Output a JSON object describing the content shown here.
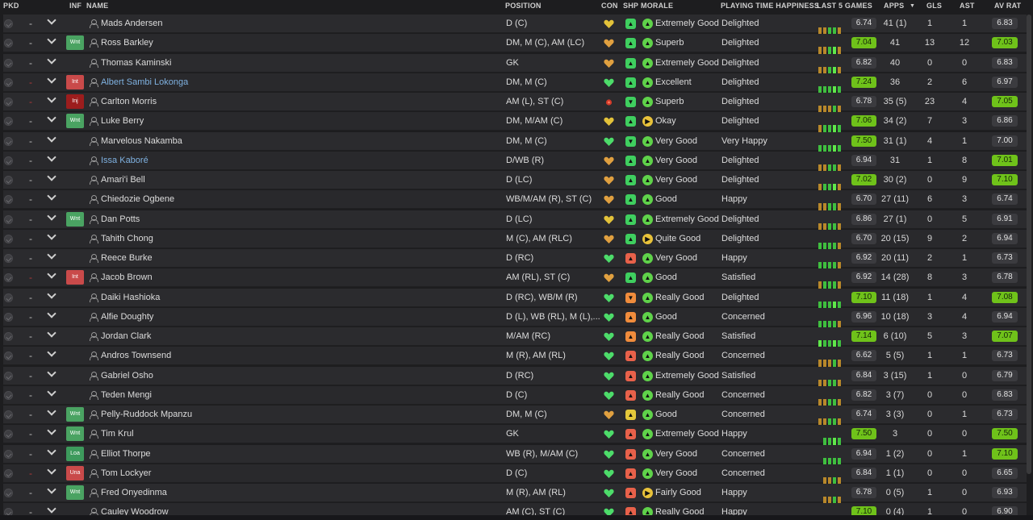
{
  "headers": {
    "pkd": "PKD",
    "inf": "INF",
    "name": "NAME",
    "position": "POSITION",
    "con": "CON",
    "shp": "SHP",
    "morale": "MORALE",
    "pth": "PLAYING TIME HAPPINESS",
    "last5": "LAST 5 GAMES",
    "apps": "APPS",
    "gls": "GLS",
    "ast": "AST",
    "avrat": "AV RAT"
  },
  "colors": {
    "rating_green": "#6fc21a",
    "accent_blue": "#7fb1e0",
    "wnt": "#4aa362",
    "int": "#c94a4a",
    "inj": "#9c1d1d"
  },
  "players": [
    {
      "dash": "-",
      "inf": "",
      "name": "Mads Andersen",
      "position": "D (C)",
      "con": "yellow",
      "shp": "up",
      "morale": "Extremely Good",
      "morale_icon": "up",
      "happiness": "Delighted",
      "bars": [
        "o",
        "o",
        "g",
        "g",
        "o"
      ],
      "r5": "6.74",
      "r5_hi": false,
      "apps": "41 (1)",
      "gls": "1",
      "ast": "1",
      "av": "6.83",
      "av_hi": false
    },
    {
      "dash": "-",
      "inf": "Wnt",
      "name": "Ross Barkley",
      "position": "DM, M (C), AM (LC)",
      "con": "orange",
      "shp": "up",
      "morale": "Superb",
      "morale_icon": "up",
      "happiness": "Delighted",
      "bars": [
        "o",
        "o",
        "g",
        "G",
        "o"
      ],
      "r5": "7.04",
      "r5_hi": true,
      "apps": "41",
      "gls": "13",
      "ast": "12",
      "av": "7.03",
      "av_hi": true
    },
    {
      "dash": "-",
      "inf": "",
      "name": "Thomas Kaminski",
      "position": "GK",
      "con": "orange",
      "shp": "up",
      "morale": "Extremely Good",
      "morale_icon": "up",
      "happiness": "Delighted",
      "bars": [
        "o",
        "o",
        "g",
        "G",
        "o"
      ],
      "r5": "6.82",
      "r5_hi": false,
      "apps": "40",
      "gls": "0",
      "ast": "0",
      "av": "6.83",
      "av_hi": false
    },
    {
      "dash": "-",
      "inf": "Int",
      "name": "Albert Sambi Lokonga",
      "link": true,
      "position": "DM, M (C)",
      "con": "green",
      "shp": "up",
      "morale": "Excellent",
      "morale_icon": "up",
      "happiness": "Delighted",
      "bars": [
        "g",
        "g",
        "g",
        "G",
        "g"
      ],
      "r5": "7.24",
      "r5_hi": true,
      "apps": "36",
      "gls": "2",
      "ast": "6",
      "av": "6.97",
      "av_hi": false
    },
    {
      "dash": "-",
      "inf": "Inj",
      "name": "Carlton Morris",
      "position": "AM (L), ST (C)",
      "con": "injury",
      "shp": "down",
      "morale": "Superb",
      "morale_icon": "up",
      "happiness": "Delighted",
      "bars": [
        "o",
        "o",
        "o",
        "g",
        "o"
      ],
      "r5": "6.78",
      "r5_hi": false,
      "apps": "35 (5)",
      "gls": "23",
      "ast": "4",
      "av": "7.05",
      "av_hi": true
    },
    {
      "dash": "-",
      "inf": "Wnt",
      "name": "Luke Berry",
      "position": "DM, M/AM (C)",
      "con": "yellow",
      "shp": "up",
      "morale": "Okay",
      "morale_icon": "right",
      "happiness": "Delighted",
      "bars": [
        "o",
        "g",
        "g",
        "G",
        "g"
      ],
      "r5": "7.06",
      "r5_hi": true,
      "apps": "34 (2)",
      "gls": "7",
      "ast": "3",
      "av": "6.86",
      "av_hi": false
    },
    {
      "dash": "-",
      "inf": "",
      "name": "Marvelous Nakamba",
      "position": "DM, M (C)",
      "con": "green",
      "shp": "down",
      "morale": "Very Good",
      "morale_icon": "up",
      "happiness": "Very Happy",
      "bars": [
        "g",
        "g",
        "g",
        "G",
        "g"
      ],
      "r5": "7.50",
      "r5_hi": true,
      "apps": "31 (1)",
      "gls": "4",
      "ast": "1",
      "av": "7.00",
      "av_hi": false
    },
    {
      "dash": "-",
      "inf": "",
      "name": "Issa Kaboré",
      "link": true,
      "position": "D/WB (R)",
      "con": "orange",
      "shp": "up",
      "morale": "Very Good",
      "morale_icon": "up",
      "happiness": "Delighted",
      "bars": [
        "o",
        "o",
        "g",
        "g",
        "o"
      ],
      "r5": "6.94",
      "r5_hi": false,
      "apps": "31",
      "gls": "1",
      "ast": "8",
      "av": "7.01",
      "av_hi": true
    },
    {
      "dash": "-",
      "inf": "",
      "name": "Amari'i Bell",
      "position": "D (LC)",
      "con": "orange",
      "shp": "up",
      "morale": "Very Good",
      "morale_icon": "up",
      "happiness": "Delighted",
      "bars": [
        "o",
        "g",
        "g",
        "G",
        "o"
      ],
      "r5": "7.02",
      "r5_hi": true,
      "apps": "30 (2)",
      "gls": "0",
      "ast": "9",
      "av": "7.10",
      "av_hi": true
    },
    {
      "dash": "-",
      "inf": "",
      "name": "Chiedozie Ogbene",
      "position": "WB/M/AM (R), ST (C)",
      "con": "orange",
      "shp": "up",
      "morale": "Good",
      "morale_icon": "up",
      "happiness": "Happy",
      "bars": [
        "o",
        "o",
        "g",
        "g",
        "o"
      ],
      "r5": "6.70",
      "r5_hi": false,
      "apps": "27 (11)",
      "gls": "6",
      "ast": "3",
      "av": "6.74",
      "av_hi": false
    },
    {
      "dash": "-",
      "inf": "Wnt",
      "name": "Dan Potts",
      "position": "D (LC)",
      "con": "yellow",
      "shp": "up",
      "morale": "Extremely Good",
      "morale_icon": "up",
      "happiness": "Delighted",
      "bars": [
        "o",
        "o",
        "g",
        "g",
        "o"
      ],
      "r5": "6.86",
      "r5_hi": false,
      "apps": "27 (1)",
      "gls": "0",
      "ast": "5",
      "av": "6.91",
      "av_hi": false
    },
    {
      "dash": "-",
      "inf": "",
      "name": "Tahith Chong",
      "position": "M (C), AM (RLC)",
      "con": "orange",
      "shp": "up",
      "morale": "Quite Good",
      "morale_icon": "right",
      "happiness": "Delighted",
      "bars": [
        "g",
        "g",
        "g",
        "g",
        "o"
      ],
      "r5": "6.70",
      "r5_hi": false,
      "apps": "20 (15)",
      "gls": "9",
      "ast": "2",
      "av": "6.94",
      "av_hi": false
    },
    {
      "dash": "-",
      "inf": "",
      "name": "Reece Burke",
      "position": "D (RC)",
      "con": "green",
      "shp": "red",
      "morale": "Very Good",
      "morale_icon": "up",
      "happiness": "Happy",
      "bars": [
        "g",
        "g",
        "g",
        "g",
        "o"
      ],
      "r5": "6.92",
      "r5_hi": false,
      "apps": "20 (11)",
      "gls": "2",
      "ast": "1",
      "av": "6.73",
      "av_hi": false
    },
    {
      "dash": "-",
      "inf": "Int",
      "name": "Jacob Brown",
      "position": "AM (RL), ST (C)",
      "con": "orange",
      "shp": "up",
      "morale": "Good",
      "morale_icon": "up",
      "happiness": "Satisfied",
      "bars": [
        "o",
        "g",
        "g",
        "g",
        "o"
      ],
      "r5": "6.92",
      "r5_hi": false,
      "apps": "14 (28)",
      "gls": "8",
      "ast": "3",
      "av": "6.78",
      "av_hi": false
    },
    {
      "dash": "-",
      "inf": "",
      "name": "Daiki Hashioka",
      "position": "D (RC), WB/M (R)",
      "con": "green",
      "shp": "orangedown",
      "morale": "Really Good",
      "morale_icon": "up",
      "happiness": "Delighted",
      "bars": [
        "g",
        "g",
        "g",
        "G",
        "g"
      ],
      "r5": "7.10",
      "r5_hi": true,
      "apps": "11 (18)",
      "gls": "1",
      "ast": "4",
      "av": "7.08",
      "av_hi": true
    },
    {
      "dash": "-",
      "inf": "",
      "name": "Alfie Doughty",
      "position": "D (L), WB (RL), M (L),...",
      "con": "green",
      "shp": "orangeup",
      "morale": "Good",
      "morale_icon": "up",
      "happiness": "Concerned",
      "bars": [
        "g",
        "g",
        "g",
        "g",
        "o"
      ],
      "r5": "6.96",
      "r5_hi": false,
      "apps": "10 (18)",
      "gls": "3",
      "ast": "4",
      "av": "6.94",
      "av_hi": false
    },
    {
      "dash": "-",
      "inf": "",
      "name": "Jordan Clark",
      "position": "M/AM (RC)",
      "con": "green",
      "shp": "orangeup",
      "morale": "Really Good",
      "morale_icon": "up",
      "happiness": "Satisfied",
      "bars": [
        "G",
        "g",
        "g",
        "G",
        "g"
      ],
      "r5": "7.14",
      "r5_hi": true,
      "apps": "6 (10)",
      "gls": "5",
      "ast": "3",
      "av": "7.07",
      "av_hi": true
    },
    {
      "dash": "-",
      "inf": "",
      "name": "Andros Townsend",
      "position": "M (R), AM (RL)",
      "con": "green",
      "shp": "red",
      "morale": "Really Good",
      "morale_icon": "up",
      "happiness": "Concerned",
      "bars": [
        "o",
        "o",
        "o",
        "g",
        "o"
      ],
      "r5": "6.62",
      "r5_hi": false,
      "apps": "5 (5)",
      "gls": "1",
      "ast": "1",
      "av": "6.73",
      "av_hi": false
    },
    {
      "dash": "-",
      "inf": "",
      "name": "Gabriel Osho",
      "position": "D (RC)",
      "con": "green",
      "shp": "red",
      "morale": "Extremely Good",
      "morale_icon": "up",
      "happiness": "Satisfied",
      "bars": [
        "o",
        "o",
        "g",
        "g",
        "o"
      ],
      "r5": "6.84",
      "r5_hi": false,
      "apps": "3 (15)",
      "gls": "1",
      "ast": "0",
      "av": "6.79",
      "av_hi": false
    },
    {
      "dash": "-",
      "inf": "",
      "name": "Teden Mengi",
      "position": "D (C)",
      "con": "green",
      "shp": "red",
      "morale": "Really Good",
      "morale_icon": "up",
      "happiness": "Concerned",
      "bars": [
        "o",
        "o",
        "g",
        "g",
        "o"
      ],
      "r5": "6.82",
      "r5_hi": false,
      "apps": "3 (7)",
      "gls": "0",
      "ast": "0",
      "av": "6.83",
      "av_hi": false
    },
    {
      "dash": "-",
      "inf": "Wnt",
      "name": "Pelly-Ruddock Mpanzu",
      "position": "DM, M (C)",
      "con": "orange",
      "shp": "yellowup",
      "morale": "Good",
      "morale_icon": "up",
      "happiness": "Concerned",
      "bars": [
        "o",
        "o",
        "g",
        "g",
        "o"
      ],
      "r5": "6.74",
      "r5_hi": false,
      "apps": "3 (3)",
      "gls": "0",
      "ast": "1",
      "av": "6.73",
      "av_hi": false
    },
    {
      "dash": "-",
      "inf": "Wnt",
      "name": "Tim Krul",
      "position": "GK",
      "con": "green",
      "shp": "red",
      "morale": "Extremely Good",
      "morale_icon": "up",
      "happiness": "Happy",
      "bars": [
        "",
        "g",
        "g",
        "G",
        "g"
      ],
      "r5": "7.50",
      "r5_hi": true,
      "apps": "3",
      "gls": "0",
      "ast": "0",
      "av": "7.50",
      "av_hi": true
    },
    {
      "dash": "-",
      "inf": "Loa",
      "name": "Elliot Thorpe",
      "position": "WB (R), M/AM (C)",
      "con": "green",
      "shp": "red",
      "morale": "Very Good",
      "morale_icon": "up",
      "happiness": "Concerned",
      "bars": [
        "",
        "g",
        "g",
        "g",
        "g"
      ],
      "r5": "6.94",
      "r5_hi": false,
      "apps": "1 (2)",
      "gls": "0",
      "ast": "1",
      "av": "7.10",
      "av_hi": true
    },
    {
      "dash": "-",
      "inf": "Una",
      "name": "Tom Lockyer",
      "position": "D (C)",
      "con": "green",
      "shp": "red",
      "morale": "Very Good",
      "morale_icon": "up",
      "happiness": "Concerned",
      "bars": [
        "",
        "o",
        "o",
        "g",
        "o"
      ],
      "r5": "6.84",
      "r5_hi": false,
      "apps": "1 (1)",
      "gls": "0",
      "ast": "0",
      "av": "6.65",
      "av_hi": false
    },
    {
      "dash": "-",
      "inf": "Wnt",
      "name": "Fred Onyedinma",
      "position": "M (R), AM (RL)",
      "con": "green",
      "shp": "red",
      "morale": "Fairly Good",
      "morale_icon": "right",
      "happiness": "Happy",
      "bars": [
        "",
        "o",
        "o",
        "g",
        "o"
      ],
      "r5": "6.78",
      "r5_hi": false,
      "apps": "0 (5)",
      "gls": "1",
      "ast": "0",
      "av": "6.93",
      "av_hi": false
    },
    {
      "dash": "-",
      "inf": "",
      "name": "Cauley Woodrow",
      "position": "AM (C), ST (C)",
      "con": "green",
      "shp": "red",
      "morale": "Really Good",
      "morale_icon": "up",
      "happiness": "Happy",
      "bars": [
        "",
        "g",
        "g",
        "G",
        "g"
      ],
      "r5": "7.10",
      "r5_hi": true,
      "apps": "0 (4)",
      "gls": "1",
      "ast": "0",
      "av": "6.90",
      "av_hi": false
    }
  ]
}
